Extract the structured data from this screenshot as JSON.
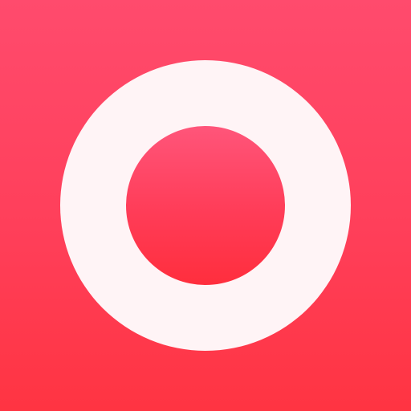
{
  "icon": {
    "name": "record-icon",
    "colors": {
      "background_top": "#ff4b6d",
      "background_bottom": "#ff3442",
      "ring": "#fff4f6",
      "dot_top": "#ff557a",
      "dot_bottom": "#ff2e3d"
    }
  }
}
